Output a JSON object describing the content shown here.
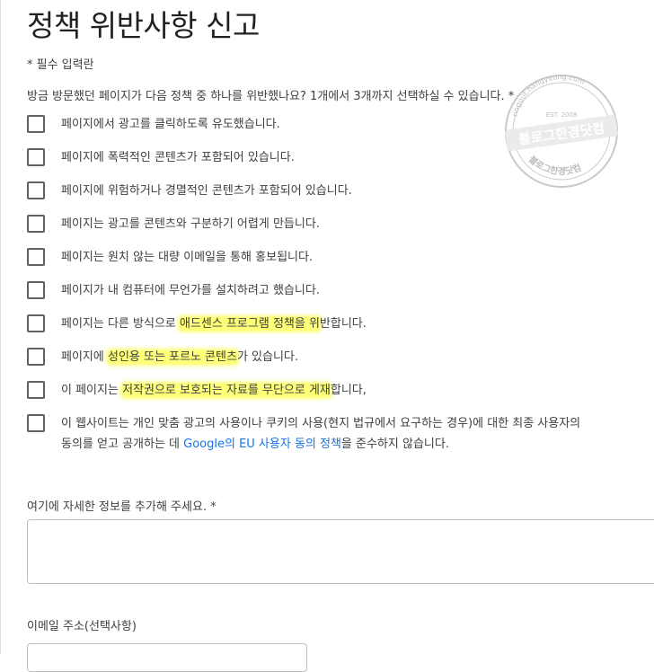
{
  "title": "정책 위반사항 신고",
  "required_note": "* 필수 입력란",
  "question": "방금 방문했던 페이지가 다음 정책 중 하나를 위반했나요? 1개에서 3개까지 선택하실 수 있습니다. *",
  "options": [
    {
      "text": "페이지에서 광고를 클릭하도록 유도했습니다."
    },
    {
      "text": "페이지에 폭력적인 콘텐츠가 포함되어 있습니다."
    },
    {
      "text": "페이지에 위험하거나 경멸적인 콘텐츠가 포함되어 있습니다."
    },
    {
      "text": "페이지는 광고를 콘텐츠와 구분하기 어렵게 만듭니다."
    },
    {
      "text": "페이지는 원치 않는 대량 이메일을 통해 홍보됩니다."
    },
    {
      "text": "페이지가 내 컴퓨터에 무언가를 설치하려고 했습니다."
    },
    {
      "pre": "페이지는 다른 방식으로 ",
      "highlight": "애드센스 프로그램 정책을 위",
      "post": "반합니다."
    },
    {
      "pre": "페이지에 ",
      "highlight": "성인용 또는 포르노 콘텐츠",
      "post": "가 있습니다."
    },
    {
      "pre": "이 페이지는 ",
      "highlight": "저작권으로 보호되는 자료를 무단으로 게재",
      "post": "합니다,"
    },
    {
      "line1": "이 웹사이트는 개인 맞춤 광고의 사용이나 쿠키의 사용(현지 법규에서 요구하는 경우)에 대한 최종 사용자의",
      "line2_pre": "동의를 얻고 공개하는 데 ",
      "link": "Google의 EU 사용자 동의 정책",
      "line2_post": "을 준수하지 않습니다."
    }
  ],
  "detail_label": "여기에 자세한 정보를 추가해 주세요. *",
  "detail_value": "",
  "email_label": "이메일 주소(선택사항)",
  "email_value": "",
  "watermark": {
    "main": "블로그한경닷컴",
    "ring_top": "ringout.hangyeong.com",
    "est": "EST. 2008"
  },
  "colors": {
    "highlight": "#ffff7a",
    "link": "#1a73e8",
    "checkbox_border": "#5f6368"
  }
}
